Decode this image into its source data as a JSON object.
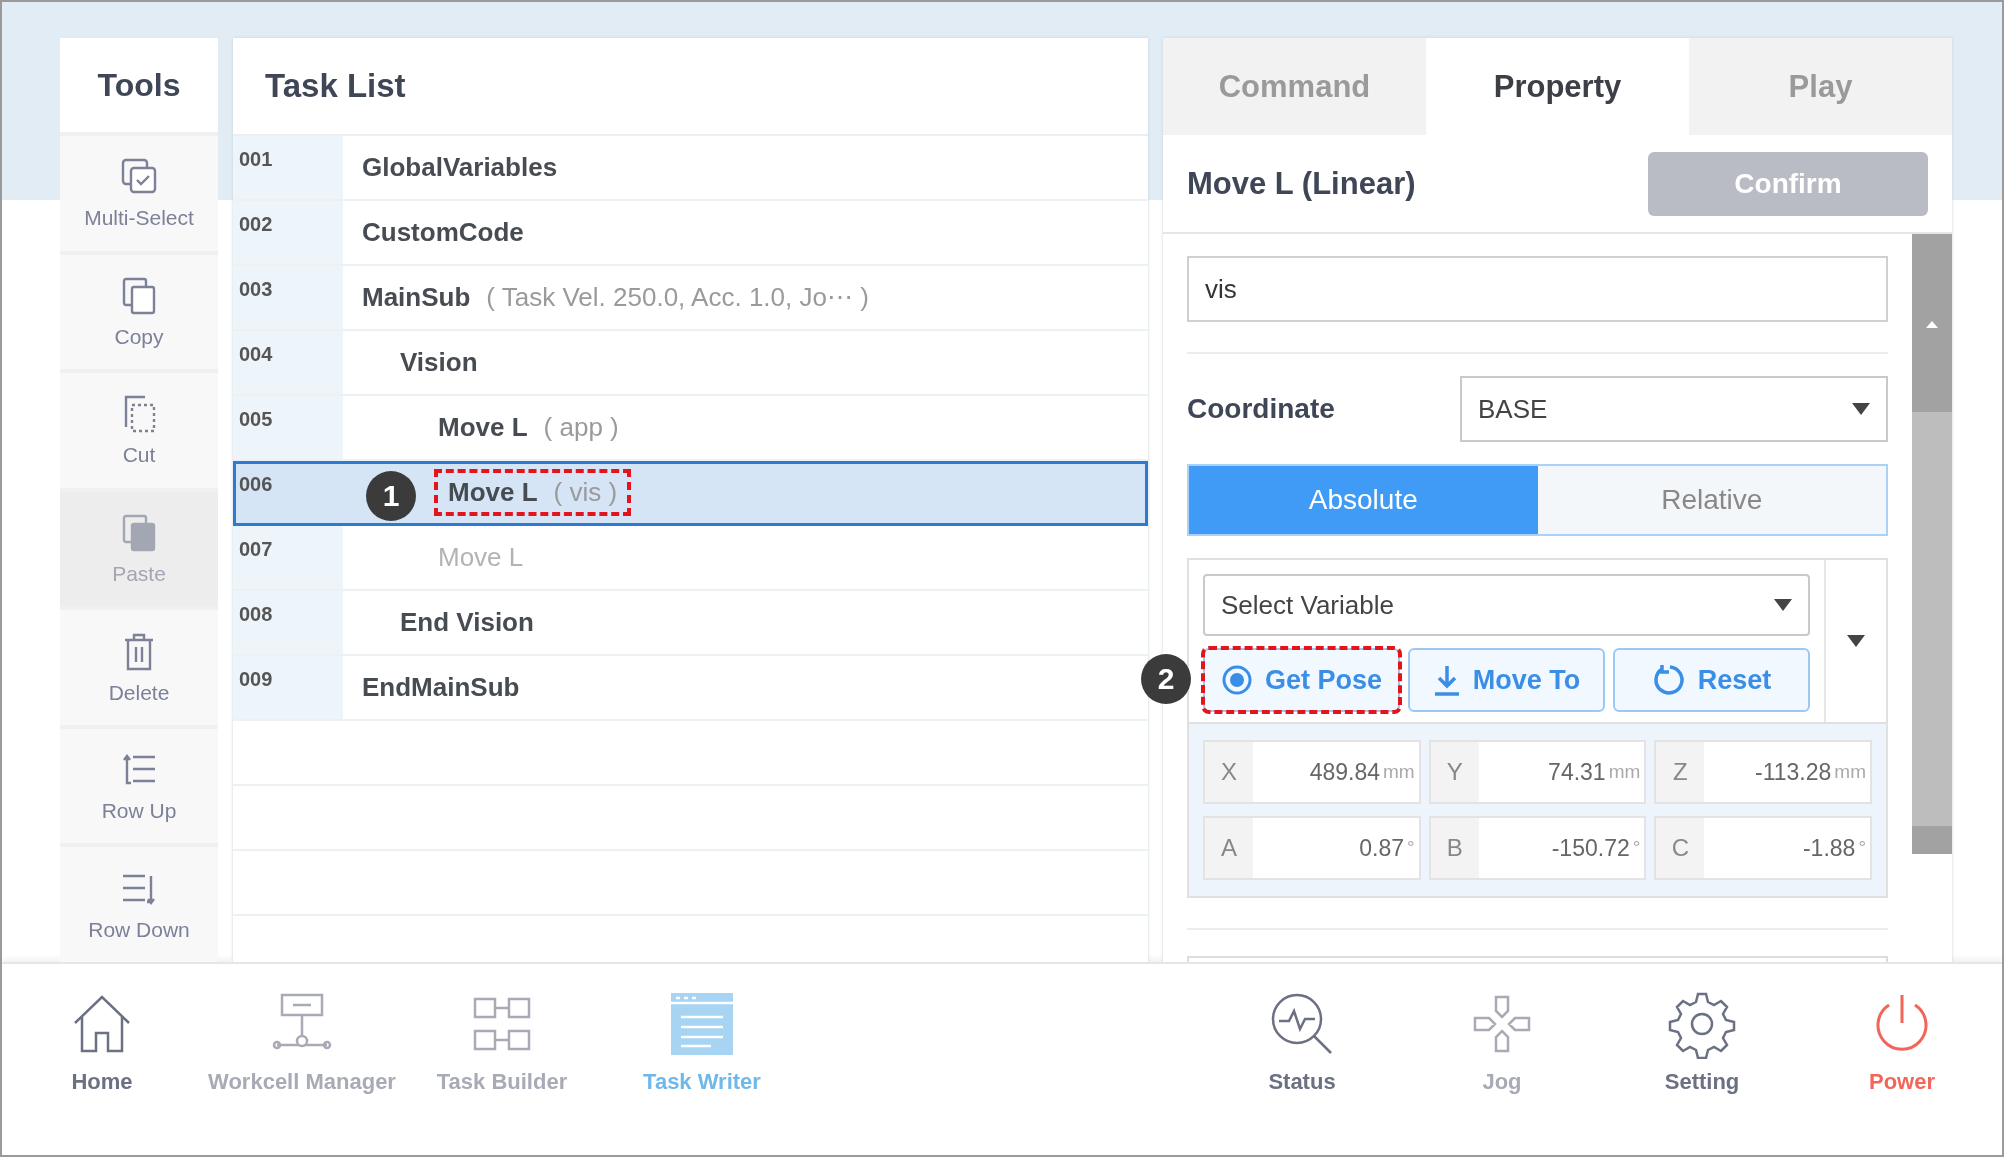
{
  "tools": {
    "title": "Tools",
    "items": [
      {
        "label": "Multi-Select",
        "kind": "multiselect",
        "disabled": false
      },
      {
        "label": "Copy",
        "kind": "copy",
        "disabled": false
      },
      {
        "label": "Cut",
        "kind": "cut",
        "disabled": false
      },
      {
        "label": "Paste",
        "kind": "paste",
        "disabled": true
      },
      {
        "label": "Delete",
        "kind": "delete",
        "disabled": false
      },
      {
        "label": "Row Up",
        "kind": "rowup",
        "disabled": false
      },
      {
        "label": "Row Down",
        "kind": "rowdown",
        "disabled": false
      }
    ]
  },
  "task_list": {
    "title": "Task List",
    "rows": [
      {
        "number": "001",
        "name": "GlobalVariables",
        "selected": false,
        "disabled": false
      },
      {
        "number": "002",
        "name": "CustomCode",
        "selected": false,
        "disabled": false
      },
      {
        "number": "003",
        "name": "MainSub",
        "detail": "( Task Vel. 250.0, Acc. 1.0, Jo⋯ )",
        "selected": false,
        "disabled": false,
        "children": [
          {
            "number": "004",
            "name": "Vision",
            "selected": false,
            "disabled": false,
            "children": [
              {
                "number": "005",
                "name": "Move L",
                "detail": "( app )",
                "selected": false,
                "disabled": false
              },
              {
                "number": "006",
                "name": "Move L",
                "detail": "( vis )",
                "selected": true,
                "disabled": false,
                "annotation": "1"
              },
              {
                "number": "007",
                "name": "Move L",
                "selected": false,
                "disabled": true
              }
            ]
          },
          {
            "number": "008",
            "name": "End Vision",
            "selected": false,
            "disabled": false
          }
        ]
      },
      {
        "number": "009",
        "name": "EndMainSub",
        "selected": false,
        "disabled": false
      }
    ]
  },
  "panel": {
    "tabs": [
      {
        "label": "Command",
        "selected": false
      },
      {
        "label": "Property",
        "selected": true
      },
      {
        "label": "Play",
        "selected": false
      }
    ],
    "title": "Move L (Linear)",
    "confirm": {
      "label": "Confirm",
      "disabled": true
    },
    "name_field": {
      "value": "vis"
    },
    "coordinate": {
      "label": "Coordinate",
      "value": "BASE"
    },
    "mode": [
      {
        "label": "Absolute",
        "selected": true
      },
      {
        "label": "Relative",
        "selected": false
      }
    ],
    "variable": {
      "placeholder": "Select Variable"
    },
    "actions": [
      {
        "label": "Get Pose",
        "kind": "getpose",
        "annotation": "2"
      },
      {
        "label": "Move To",
        "kind": "moveto"
      },
      {
        "label": "Reset",
        "kind": "reset"
      }
    ],
    "pose": [
      {
        "axis": "X",
        "value": "489.84",
        "unit": "mm"
      },
      {
        "axis": "Y",
        "value": "74.31",
        "unit": "mm"
      },
      {
        "axis": "Z",
        "value": "-113.28",
        "unit": "mm"
      },
      {
        "axis": "A",
        "value": "0.87",
        "unit": "°"
      },
      {
        "axis": "B",
        "value": "-150.72",
        "unit": "°"
      },
      {
        "axis": "C",
        "value": "-1.88",
        "unit": "°"
      }
    ]
  },
  "nav": {
    "left": [
      {
        "label": "Home",
        "kind": "home",
        "selected": false,
        "disabled": false
      },
      {
        "label": "Workcell Manager",
        "kind": "workcell",
        "selected": false,
        "disabled": true
      },
      {
        "label": "Task Builder",
        "kind": "builder",
        "selected": false,
        "disabled": true
      },
      {
        "label": "Task Writer",
        "kind": "writer",
        "selected": true,
        "disabled": false
      }
    ],
    "right": [
      {
        "label": "Status",
        "kind": "status",
        "selected": false,
        "disabled": false
      },
      {
        "label": "Jog",
        "kind": "jog",
        "selected": false,
        "disabled": true
      },
      {
        "label": "Setting",
        "kind": "setting",
        "selected": false,
        "disabled": false
      },
      {
        "label": "Power",
        "kind": "power",
        "selected": false,
        "disabled": false
      }
    ]
  }
}
